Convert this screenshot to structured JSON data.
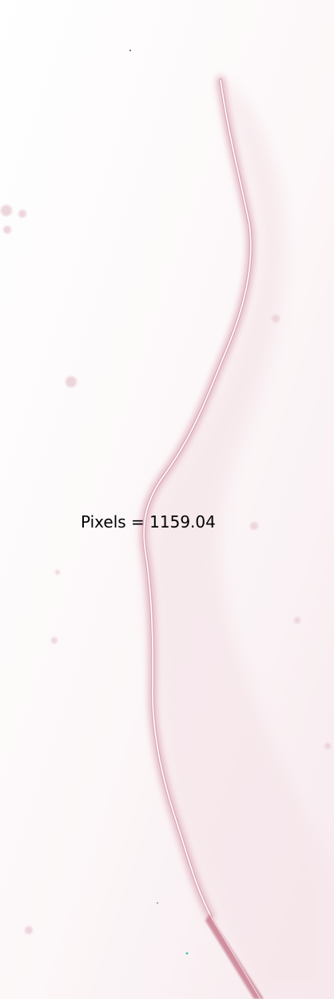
{
  "measurement": {
    "label": "Pixels = 1159.04"
  },
  "colors": {
    "background": "#ffffff",
    "haze": "#f6e6ea",
    "trace_edge": "#d9a9b6",
    "trace_core": "#ffffff",
    "tip": "#c97f91",
    "label_text": "#000000"
  }
}
